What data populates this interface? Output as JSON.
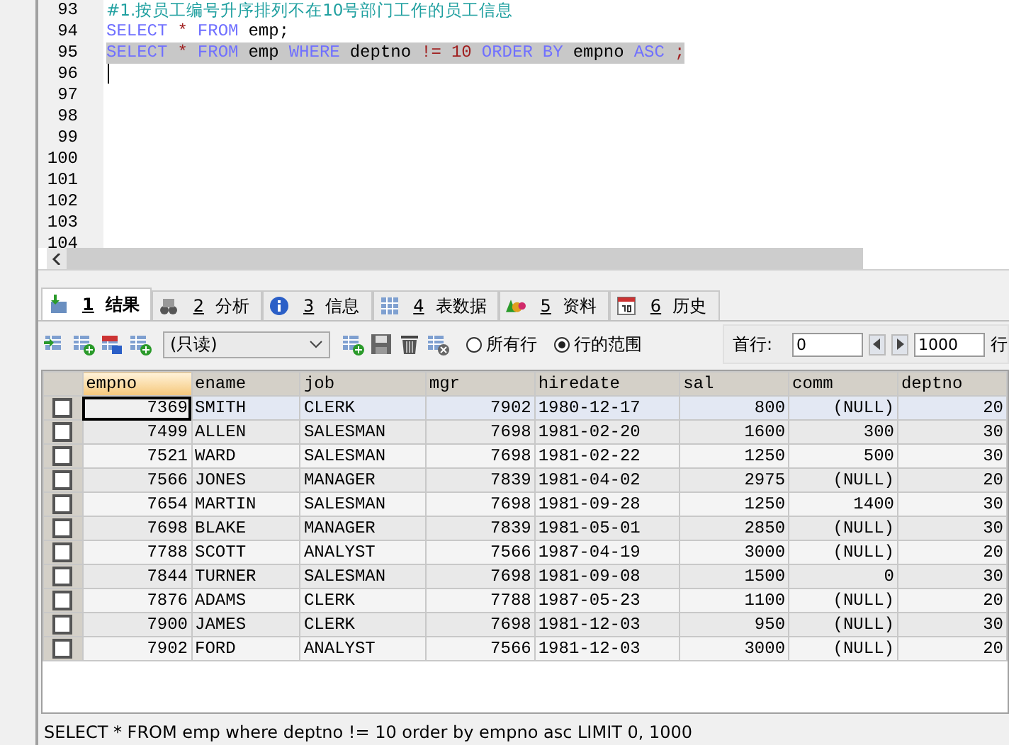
{
  "editor": {
    "lines": [
      {
        "number": "93",
        "selected": false,
        "caret": false,
        "tokens": [
          {
            "kind": "comment",
            "text": "#1.按员工编号升序排列不在10号部门工作的员工信息"
          }
        ]
      },
      {
        "number": "94",
        "selected": false,
        "caret": false,
        "tokens": [
          {
            "kind": "keyword",
            "text": "SELECT"
          },
          {
            "kind": "op",
            "text": "*"
          },
          {
            "kind": "keyword",
            "text": "FROM"
          },
          {
            "kind": "ident",
            "text": "emp;"
          }
        ]
      },
      {
        "number": "95",
        "selected": true,
        "caret": false,
        "tokens": [
          {
            "kind": "keyword",
            "text": "SELECT"
          },
          {
            "kind": "op",
            "text": "*"
          },
          {
            "kind": "keyword",
            "text": "FROM"
          },
          {
            "kind": "ident",
            "text": "emp"
          },
          {
            "kind": "keyword",
            "text": "WHERE"
          },
          {
            "kind": "ident",
            "text": "deptno"
          },
          {
            "kind": "op",
            "text": "!="
          },
          {
            "kind": "number",
            "text": "10"
          },
          {
            "kind": "keyword",
            "text": "ORDER"
          },
          {
            "kind": "keyword",
            "text": "BY"
          },
          {
            "kind": "ident",
            "text": "empno"
          },
          {
            "kind": "keyword",
            "text": "ASC"
          },
          {
            "kind": "op",
            "text": ";"
          }
        ]
      },
      {
        "number": "96",
        "selected": false,
        "caret": true
      },
      {
        "number": "97",
        "selected": false,
        "caret": false
      },
      {
        "number": "98",
        "selected": false,
        "caret": false
      },
      {
        "number": "99",
        "selected": false,
        "caret": false
      },
      {
        "number": "100",
        "selected": false,
        "caret": false
      },
      {
        "number": "101",
        "selected": false,
        "caret": false
      },
      {
        "number": "102",
        "selected": false,
        "caret": false
      },
      {
        "number": "103",
        "selected": false,
        "caret": false
      },
      {
        "number": "104",
        "selected": false,
        "caret": false
      }
    ]
  },
  "tabs": [
    {
      "key": "1",
      "label": "结果",
      "selected": true
    },
    {
      "key": "2",
      "label": "分析",
      "selected": false
    },
    {
      "key": "3",
      "label": "信息",
      "selected": false
    },
    {
      "key": "4",
      "label": "表数据",
      "selected": false
    },
    {
      "key": "5",
      "label": "资料",
      "selected": false
    },
    {
      "key": "6",
      "label": "历史",
      "selected": false
    }
  ],
  "toolbar": {
    "mode": "(只读)",
    "row_options": [
      {
        "label": "所有行",
        "selected": false
      },
      {
        "label": "行的范围",
        "selected": true
      }
    ],
    "first_row_label": "首行:",
    "first_row": "0",
    "row_count": "1000",
    "rows_label": "行"
  },
  "grid": {
    "columns": [
      {
        "name": "empno",
        "kind": "number",
        "selected": true
      },
      {
        "name": "ename",
        "kind": "text",
        "selected": false
      },
      {
        "name": "job",
        "kind": "text",
        "selected": false
      },
      {
        "name": "mgr",
        "kind": "number",
        "selected": false
      },
      {
        "name": "hiredate",
        "kind": "text",
        "selected": false
      },
      {
        "name": "sal",
        "kind": "number",
        "selected": false
      },
      {
        "name": "comm",
        "kind": "number",
        "selected": false
      },
      {
        "name": "deptno",
        "kind": "number",
        "selected": false
      }
    ],
    "rows": [
      {
        "checked": false,
        "selected": true,
        "cells": [
          "7369",
          "SMITH",
          "CLERK",
          "7902",
          "1980-12-17",
          "800",
          "(NULL)",
          "20"
        ]
      },
      {
        "checked": false,
        "selected": false,
        "cells": [
          "7499",
          "ALLEN",
          "SALESMAN",
          "7698",
          "1981-02-20",
          "1600",
          "300",
          "30"
        ]
      },
      {
        "checked": false,
        "selected": false,
        "cells": [
          "7521",
          "WARD",
          "SALESMAN",
          "7698",
          "1981-02-22",
          "1250",
          "500",
          "30"
        ]
      },
      {
        "checked": false,
        "selected": false,
        "cells": [
          "7566",
          "JONES",
          "MANAGER",
          "7839",
          "1981-04-02",
          "2975",
          "(NULL)",
          "20"
        ]
      },
      {
        "checked": false,
        "selected": false,
        "cells": [
          "7654",
          "MARTIN",
          "SALESMAN",
          "7698",
          "1981-09-28",
          "1250",
          "1400",
          "30"
        ]
      },
      {
        "checked": false,
        "selected": false,
        "cells": [
          "7698",
          "BLAKE",
          "MANAGER",
          "7839",
          "1981-05-01",
          "2850",
          "(NULL)",
          "30"
        ]
      },
      {
        "checked": false,
        "selected": false,
        "cells": [
          "7788",
          "SCOTT",
          "ANALYST",
          "7566",
          "1987-04-19",
          "3000",
          "(NULL)",
          "20"
        ]
      },
      {
        "checked": false,
        "selected": false,
        "cells": [
          "7844",
          "TURNER",
          "SALESMAN",
          "7698",
          "1981-09-08",
          "1500",
          "0",
          "30"
        ]
      },
      {
        "checked": false,
        "selected": false,
        "cells": [
          "7876",
          "ADAMS",
          "CLERK",
          "7788",
          "1987-05-23",
          "1100",
          "(NULL)",
          "20"
        ]
      },
      {
        "checked": false,
        "selected": false,
        "cells": [
          "7900",
          "JAMES",
          "CLERK",
          "7698",
          "1981-12-03",
          "950",
          "(NULL)",
          "30"
        ]
      },
      {
        "checked": false,
        "selected": false,
        "cells": [
          "7902",
          "FORD",
          "ANALYST",
          "7566",
          "1981-12-03",
          "3000",
          "(NULL)",
          "20"
        ]
      }
    ]
  },
  "status_bar": {
    "text": "SELECT * FROM emp where deptno != 10 order by empno asc LIMIT 0, 1000"
  }
}
